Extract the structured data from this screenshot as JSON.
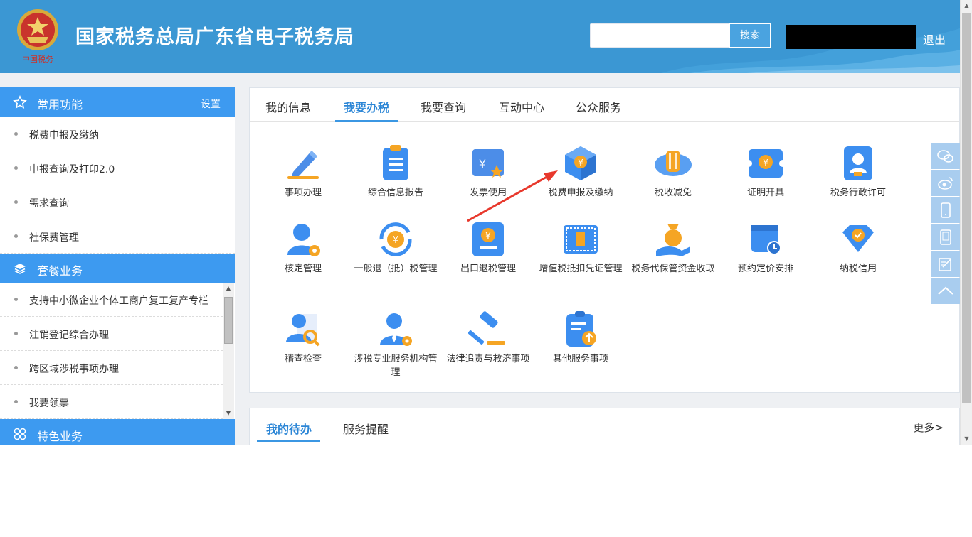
{
  "header": {
    "title": "国家税务总局广东省电子税务局",
    "emblem_text": "中国税务",
    "search_placeholder": "",
    "search_button": "搜索",
    "logout": "退出"
  },
  "sidebar": {
    "common": {
      "title": "常用功能",
      "settings": "设置"
    },
    "common_items": [
      "税费申报及缴纳",
      "申报查询及打印2.0",
      "需求查询",
      "社保费管理"
    ],
    "package": {
      "title": "套餐业务"
    },
    "package_items": [
      "支持中小微企业个体工商户复工复产专栏",
      "注销登记综合办理",
      "跨区域涉税事项办理",
      "我要领票"
    ],
    "special": {
      "title": "特色业务"
    }
  },
  "main": {
    "tabs": [
      "我的信息",
      "我要办税",
      "我要查询",
      "互动中心",
      "公众服务"
    ],
    "active_tab": "我要办税",
    "services": [
      {
        "label": "事项办理",
        "icon": "pencil-icon"
      },
      {
        "label": "综合信息报告",
        "icon": "clipboard-icon"
      },
      {
        "label": "发票使用",
        "icon": "invoice-icon"
      },
      {
        "label": "税费申报及缴纳",
        "icon": "tax-cube-icon"
      },
      {
        "label": "税收减免",
        "icon": "coin-stack-icon"
      },
      {
        "label": "证明开具",
        "icon": "certificate-icon"
      },
      {
        "label": "税务行政许可",
        "icon": "license-icon"
      },
      {
        "label": "核定管理",
        "icon": "user-gear-icon"
      },
      {
        "label": "一般退（抵）税管理",
        "icon": "refund-icon"
      },
      {
        "label": "出口退税管理",
        "icon": "export-refund-icon"
      },
      {
        "label": "增值税抵扣凭证管理",
        "icon": "vat-voucher-icon"
      },
      {
        "label": "税务代保管资金收取",
        "icon": "money-bag-icon"
      },
      {
        "label": "预约定价安排",
        "icon": "calendar-clock-icon"
      },
      {
        "label": "纳税信用",
        "icon": "diamond-icon"
      },
      {
        "label": "稽查检查",
        "icon": "inspect-icon"
      },
      {
        "label": "涉税专业服务机构管理",
        "icon": "agent-icon"
      },
      {
        "label": "法律追责与救济事项",
        "icon": "gavel-icon"
      },
      {
        "label": "其他服务事项",
        "icon": "other-services-icon"
      }
    ]
  },
  "todo": {
    "tabs": [
      "我的待办",
      "服务提醒"
    ],
    "more": "更多>"
  },
  "floating": [
    "wechat-icon",
    "weibo-icon",
    "phone-icon",
    "tablet-icon",
    "feedback-icon",
    "back-to-top-icon"
  ],
  "colors": {
    "header": "#3b97d3",
    "accent": "#3d9af0",
    "active_text": "#2c86d6",
    "arrow": "#e8382c"
  }
}
